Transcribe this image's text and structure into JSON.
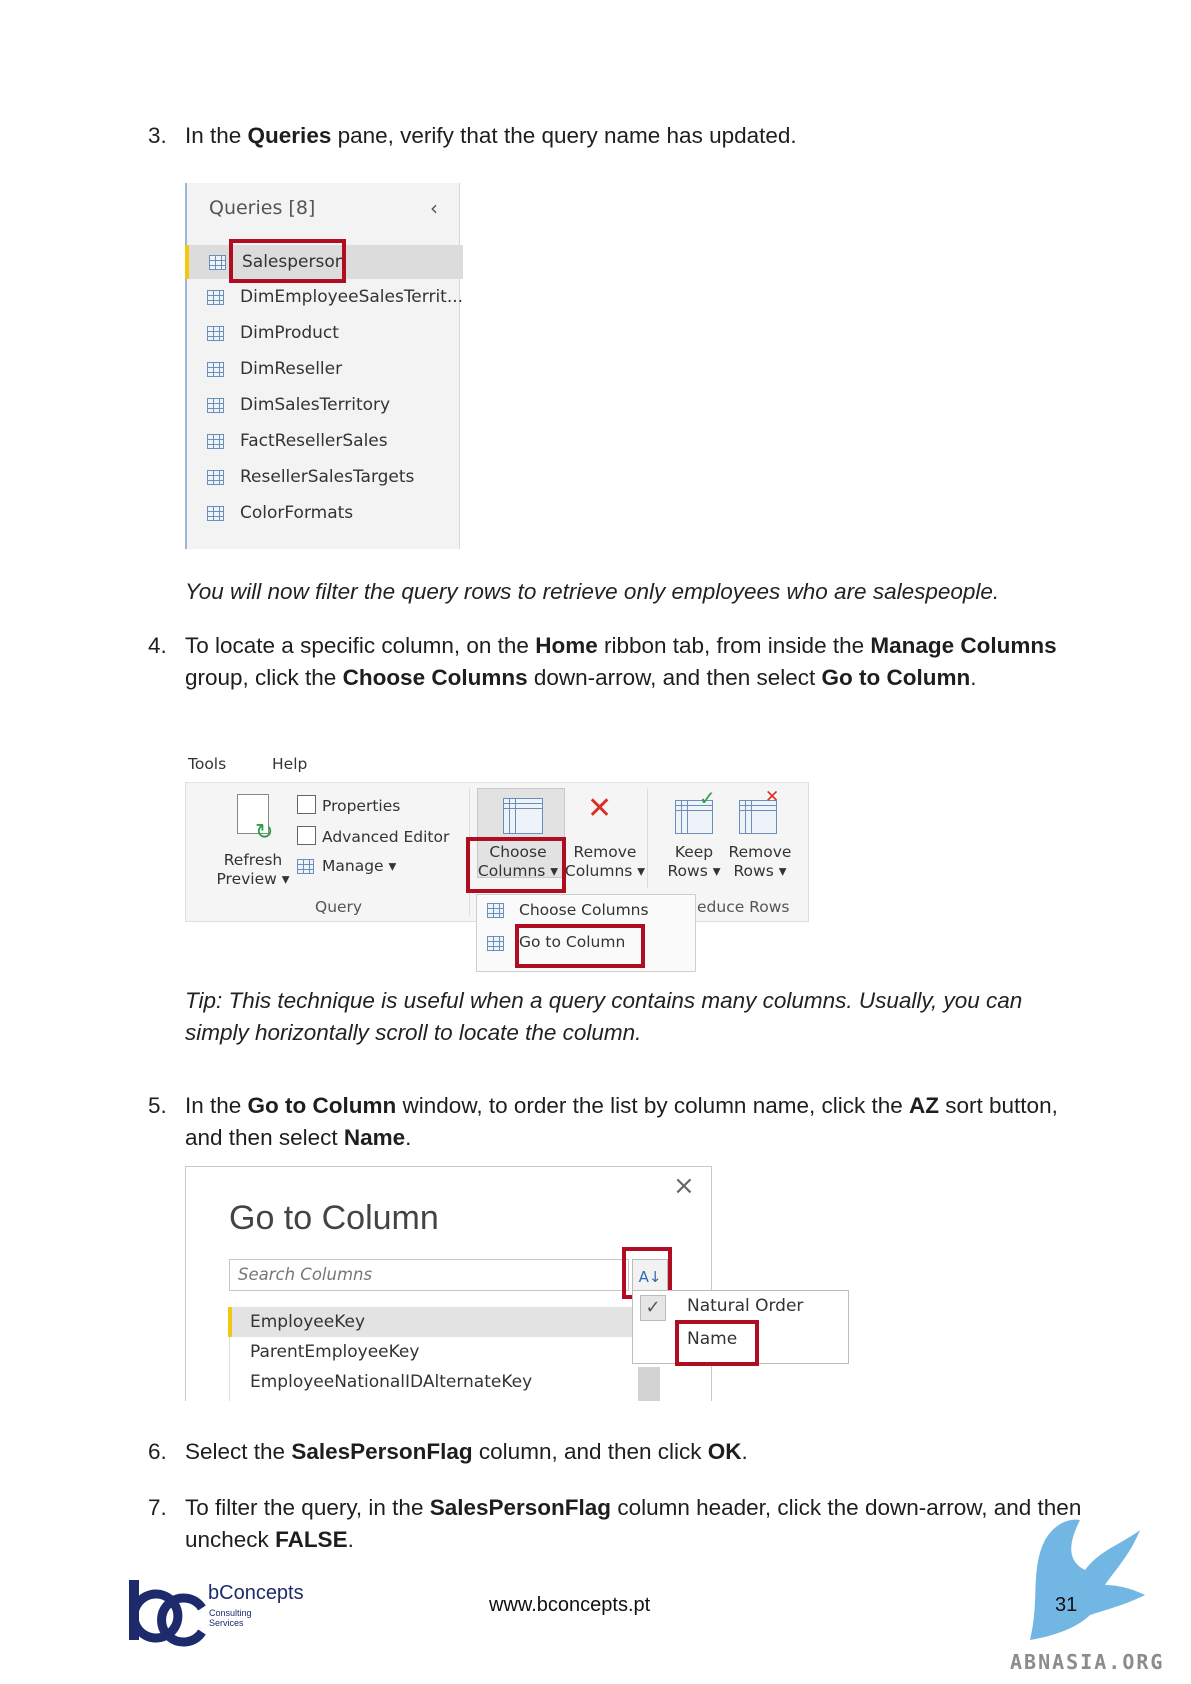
{
  "steps": {
    "s3": {
      "num": "3.",
      "pre": "In the ",
      "b1": "Queries",
      "post": " pane, verify that the query name has updated."
    },
    "note1": "You will now filter the query rows to retrieve only employees who are salespeople.",
    "s4": {
      "num": "4.",
      "t1": "To locate a specific column, on the ",
      "b1": "Home",
      "t2": " ribbon tab, from inside the ",
      "b2": "Manage Columns",
      "t3": " group, click the ",
      "b3": "Choose Columns",
      "t4": " down-arrow, and then select ",
      "b4": "Go to Column",
      "t5": "."
    },
    "note2": "Tip: This technique is useful when a query contains many columns. Usually, you can simply horizontally scroll to locate the column.",
    "s5": {
      "num": "5.",
      "t1": "In the ",
      "b1": "Go to Column",
      "t2": " window, to order the list by column name, click the ",
      "b2": "AZ",
      "t3": " sort button, and then select ",
      "b3": "Name",
      "t4": "."
    },
    "s6": {
      "num": "6.",
      "t1": "Select the ",
      "b1": "SalesPersonFlag",
      "t2": " column, and then click ",
      "b2": "OK",
      "t3": "."
    },
    "s7": {
      "num": "7.",
      "t1": "To filter the query, in the ",
      "b1": "SalesPersonFlag",
      "t2": " column header, click the down-arrow, and then uncheck ",
      "b2": "FALSE",
      "t3": "."
    }
  },
  "queries_pane": {
    "title": "Queries [8]",
    "collapse_icon": "chevron-left-icon",
    "items": [
      "Salesperson",
      "DimEmployeeSalesTerrit...",
      "DimProduct",
      "DimReseller",
      "DimSalesTerritory",
      "FactResellerSales",
      "ResellerSalesTargets",
      "ColorFormats"
    ]
  },
  "ribbon": {
    "tabs": [
      "Tools",
      "Help"
    ],
    "refresh_preview": [
      "Refresh",
      "Preview ▾"
    ],
    "properties": "Properties",
    "advanced_editor": "Advanced Editor",
    "manage": "Manage ▾",
    "query_group": "Query",
    "choose_columns": [
      "Choose",
      "Columns ▾"
    ],
    "remove_columns": [
      "Remove",
      "Columns ▾"
    ],
    "keep_rows": [
      "Keep",
      "Rows ▾"
    ],
    "remove_rows": [
      "Remove",
      "Rows ▾"
    ],
    "reduce_rows_partial": "educe Rows",
    "dropdown": [
      "Choose Columns",
      "Go to Column"
    ]
  },
  "go_to_column": {
    "title": "Go to Column",
    "search_placeholder": "Search Columns",
    "columns": [
      "EmployeeKey",
      "ParentEmployeeKey",
      "EmployeeNationalIDAlternateKey"
    ],
    "sort_menu": [
      "Natural Order",
      "Name"
    ]
  },
  "footer": {
    "brand": "bConcepts",
    "brand_sub1": "Consulting",
    "brand_sub2": "Services",
    "url": "www.bconcepts.pt",
    "page": "31",
    "watermark": "ABNASIA.ORG"
  },
  "colors": {
    "highlight_red": "#b00d23",
    "brand_navy": "#1d2a6b",
    "watermark_blue": "#59a9df"
  }
}
